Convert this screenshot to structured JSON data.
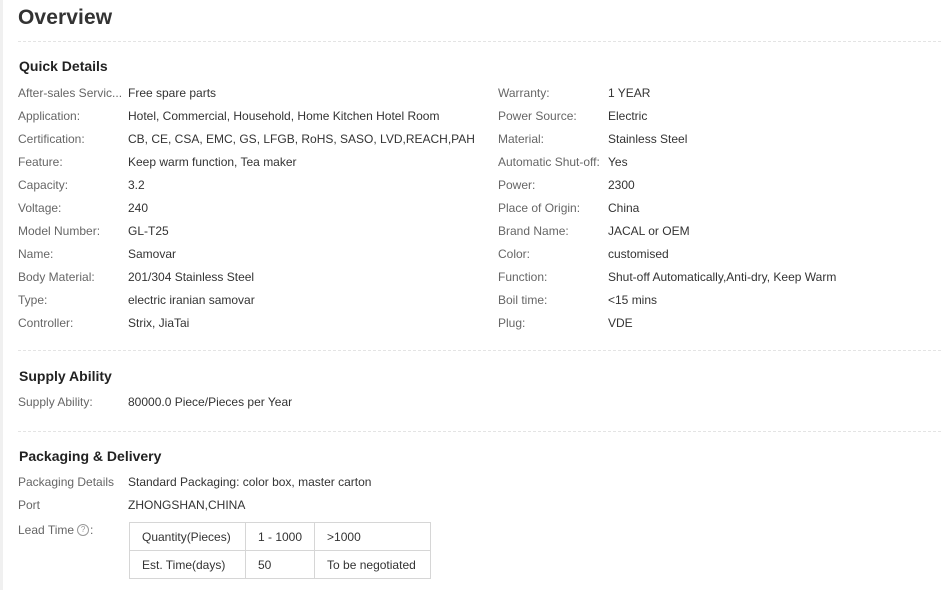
{
  "page": {
    "title": "Overview"
  },
  "quick_details": {
    "title": "Quick Details",
    "rows": [
      {
        "l_key": "After-sales Service Provided:",
        "l_key_shown": "After-sales Servic...",
        "l_val": "Free spare parts",
        "r_key": "Warranty:",
        "r_val": "1 YEAR"
      },
      {
        "l_key": "Application:",
        "l_key_shown": "Application:",
        "l_val": "Hotel, Commercial, Household, Home Kitchen Hotel Room",
        "r_key": "Power Source:",
        "r_val": "Electric"
      },
      {
        "l_key": "Certification:",
        "l_key_shown": "Certification:",
        "l_val": "CB, CE, CSA, EMC, GS, LFGB, RoHS, SASO, LVD,REACH,PAH",
        "r_key": "Material:",
        "r_val": "Stainless Steel"
      },
      {
        "l_key": "Feature:",
        "l_key_shown": "Feature:",
        "l_val": "Keep warm function, Tea maker",
        "r_key": "Automatic Shut-off:",
        "r_val": "Yes"
      },
      {
        "l_key": "Capacity:",
        "l_key_shown": "Capacity:",
        "l_val": "3.2",
        "r_key": "Power:",
        "r_val": "2300"
      },
      {
        "l_key": "Voltage:",
        "l_key_shown": "Voltage:",
        "l_val": "240",
        "r_key": "Place of Origin:",
        "r_val": "China"
      },
      {
        "l_key": "Model Number:",
        "l_key_shown": "Model Number:",
        "l_val": "GL-T25",
        "r_key": "Brand Name:",
        "r_val": "JACAL or OEM"
      },
      {
        "l_key": "Name:",
        "l_key_shown": "Name:",
        "l_val": "Samovar",
        "r_key": "Color:",
        "r_val": "customised"
      },
      {
        "l_key": "Body Material:",
        "l_key_shown": "Body Material:",
        "l_val": "201/304 Stainless Steel",
        "r_key": "Function:",
        "r_val": "Shut-off Automatically,Anti-dry, Keep Warm"
      },
      {
        "l_key": "Type:",
        "l_key_shown": "Type:",
        "l_val": "electric iranian samovar",
        "r_key": "Boil time:",
        "r_val": "<15 mins"
      },
      {
        "l_key": "Controller:",
        "l_key_shown": "Controller:",
        "l_val": "Strix, JiaTai",
        "r_key": "Plug:",
        "r_val": "VDE"
      }
    ]
  },
  "supply_ability": {
    "title": "Supply Ability",
    "key": "Supply Ability:",
    "value": "80000.0 Piece/Pieces per Year"
  },
  "packaging": {
    "title": "Packaging & Delivery",
    "details_key": "Packaging Details",
    "details_value": "Standard Packaging: color box, master carton",
    "port_key": "Port",
    "port_value": "ZHONGSHAN,CHINA",
    "lead_time_key": "Lead Time",
    "lead_time_suffix": ":",
    "help_icon_glyph": "?",
    "lead_table": {
      "row1": [
        "Quantity(Pieces)",
        "1 - 1000",
        ">1000"
      ],
      "row2": [
        "Est. Time(days)",
        "50",
        "To be negotiated"
      ]
    }
  }
}
